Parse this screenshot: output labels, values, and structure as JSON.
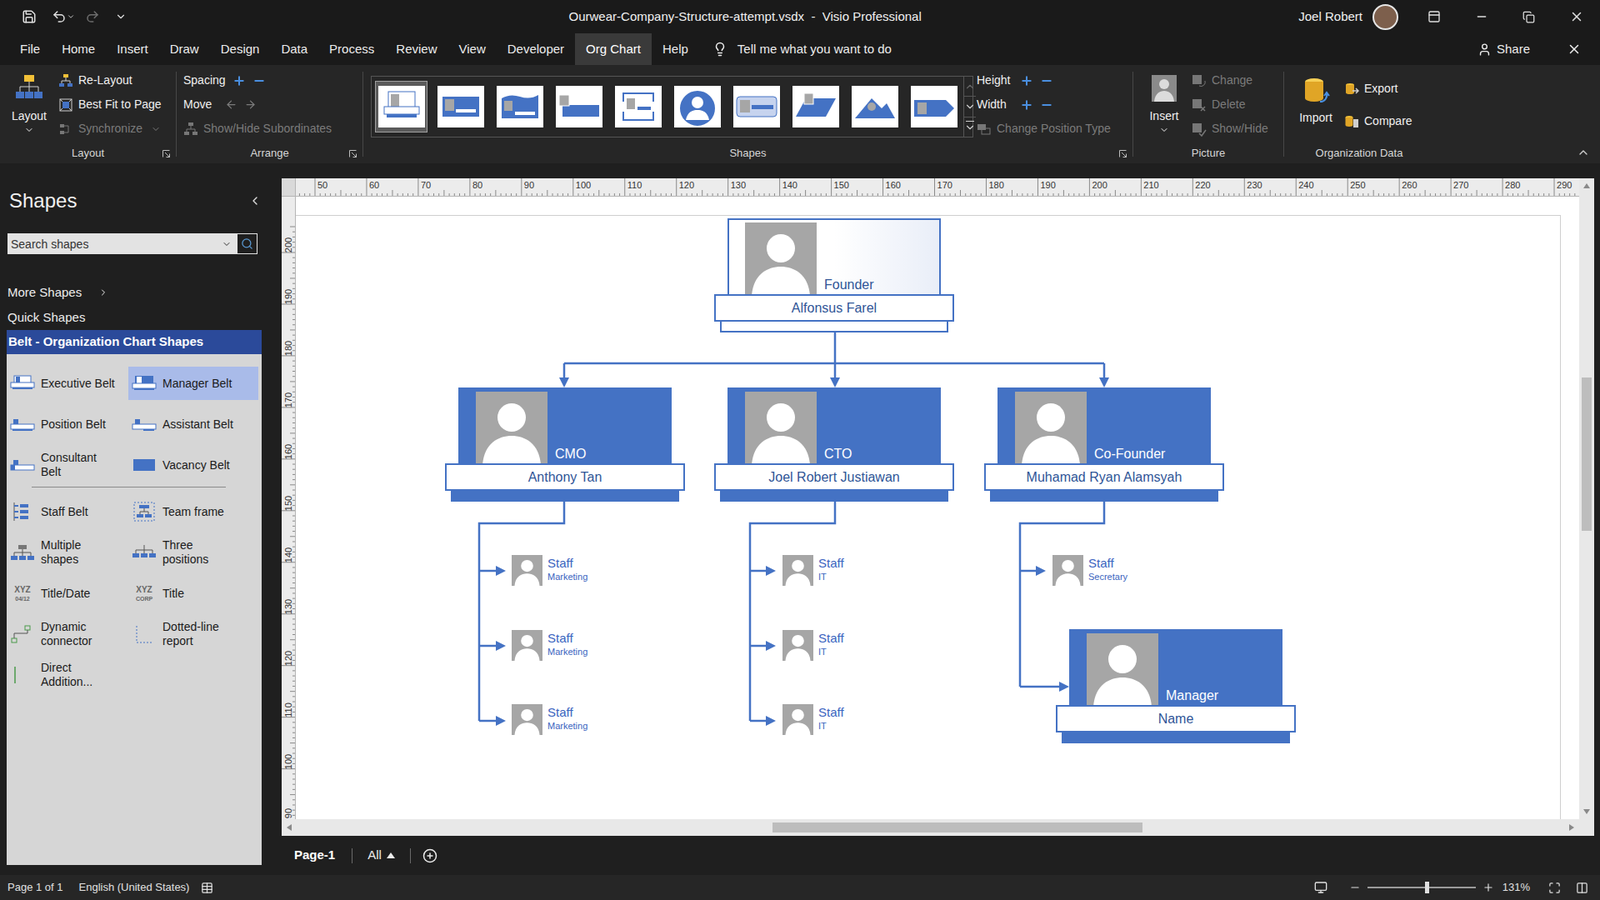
{
  "window": {
    "title": "Ourwear-Company-Structure-attempt.vsdx  -  Visio Professional",
    "user": "Joel Robert"
  },
  "menu": [
    {
      "label": "File",
      "selected": false
    },
    {
      "label": "Home",
      "selected": false
    },
    {
      "label": "Insert",
      "selected": false
    },
    {
      "label": "Draw",
      "selected": false
    },
    {
      "label": "Design",
      "selected": false
    },
    {
      "label": "Data",
      "selected": false
    },
    {
      "label": "Process",
      "selected": false
    },
    {
      "label": "Review",
      "selected": false
    },
    {
      "label": "View",
      "selected": false
    },
    {
      "label": "Developer",
      "selected": false
    },
    {
      "label": "Org Chart",
      "selected": true
    },
    {
      "label": "Help",
      "selected": false
    }
  ],
  "tell_me": "Tell me what you want to do",
  "share": "Share",
  "ribbon": {
    "layout": {
      "label": "Layout",
      "main": "Layout",
      "items": [
        {
          "label": "Re-Layout",
          "disabled": false,
          "kind": "relayout"
        },
        {
          "label": "Best Fit to Page",
          "disabled": false,
          "kind": "bestfit"
        },
        {
          "label": "Synchronize",
          "disabled": true,
          "kind": "sync"
        }
      ]
    },
    "arrange": {
      "label": "Arrange",
      "spacing": "Spacing",
      "move": "Move",
      "subordinates": {
        "label": "Show/Hide Subordinates",
        "disabled": true
      }
    },
    "shapes": {
      "label": "Shapes",
      "styles": [
        {
          "kind": "belt",
          "selected": true
        },
        {
          "kind": "block",
          "selected": false
        },
        {
          "kind": "notch",
          "selected": false
        },
        {
          "kind": "tab",
          "selected": false
        },
        {
          "kind": "bracket",
          "selected": false
        },
        {
          "kind": "circle",
          "selected": false
        },
        {
          "kind": "card",
          "selected": false
        },
        {
          "kind": "ribbon",
          "selected": false
        },
        {
          "kind": "triangle",
          "selected": false
        },
        {
          "kind": "arrow",
          "selected": false
        }
      ],
      "height": "Height",
      "width": "Width",
      "position_type": {
        "label": "Change Position Type",
        "disabled": true
      }
    },
    "picture": {
      "label": "Picture",
      "insert": "Insert",
      "items": [
        {
          "label": "Change",
          "disabled": true
        },
        {
          "label": "Delete",
          "disabled": true
        },
        {
          "label": "Show/Hide",
          "disabled": true
        }
      ]
    },
    "org_data": {
      "label": "Organization Data",
      "import": "Import",
      "items": [
        {
          "label": "Export",
          "disabled": false
        },
        {
          "label": "Compare",
          "disabled": false
        }
      ]
    }
  },
  "shapes_pane": {
    "title": "Shapes",
    "search_placeholder": "Search shapes",
    "links": [
      {
        "label": "More Shapes",
        "has_submenu": true
      },
      {
        "label": "Quick Shapes",
        "has_submenu": false
      }
    ],
    "stencil": {
      "label": "Belt - Organization Chart Shapes",
      "selected": true
    },
    "groups": [
      [
        {
          "label": "Executive Belt",
          "kind": "executive",
          "selected": false
        },
        {
          "label": "Manager Belt",
          "kind": "manager",
          "selected": true
        },
        {
          "label": "Position Belt",
          "kind": "position",
          "selected": false
        },
        {
          "label": "Assistant Belt",
          "kind": "assistant",
          "selected": false
        },
        {
          "label": "Consultant Belt",
          "kind": "consultant",
          "selected": false
        },
        {
          "label": "Vacancy Belt",
          "kind": "vacancy",
          "selected": false
        }
      ],
      [
        {
          "label": "Staff Belt",
          "kind": "staff",
          "selected": false
        },
        {
          "label": "Team frame",
          "kind": "team",
          "selected": false
        },
        {
          "label": "Multiple shapes",
          "kind": "multiple",
          "selected": false
        },
        {
          "label": "Three positions",
          "kind": "three",
          "selected": false
        },
        {
          "label": "Title/Date",
          "kind": "titledate",
          "selected": false,
          "icon_text": "XYZ",
          "icon_subtext": "04/12"
        },
        {
          "label": "Title",
          "kind": "title",
          "selected": false,
          "icon_text": "XYZ",
          "icon_subtext": "CORP"
        },
        {
          "label": "Dynamic connector",
          "kind": "connector",
          "selected": false
        },
        {
          "label": "Dotted-line report",
          "kind": "dotted",
          "selected": false
        },
        {
          "label": "Direct Addition...",
          "kind": "direct",
          "selected": false
        }
      ]
    ]
  },
  "rulers": {
    "horizontal": [
      "50",
      "60",
      "70",
      "80",
      "90",
      "100",
      "110",
      "120",
      "130",
      "140",
      "150",
      "160",
      "170",
      "180",
      "190",
      "200",
      "210",
      "220",
      "230",
      "240",
      "250",
      "260",
      "270",
      "280",
      "290"
    ],
    "vertical": [
      "200",
      "190",
      "180",
      "170",
      "160",
      "150",
      "140",
      "130",
      "120",
      "110",
      "100",
      "90"
    ]
  },
  "chart": {
    "executives": [
      {
        "title": "Founder",
        "name": "Alfonsus Farel",
        "kind": "outline"
      },
      {
        "title": "CMO",
        "name": "Anthony Tan",
        "kind": "filled"
      },
      {
        "title": "CTO",
        "name": "Joel Robert Justiawan",
        "kind": "filled"
      },
      {
        "title": "Co-Founder",
        "name": "Muhamad Ryan Alamsyah",
        "kind": "filled"
      },
      {
        "title": "Manager",
        "name": "Name",
        "kind": "filled"
      }
    ],
    "staff": [
      {
        "title": "Staff",
        "dept": "Marketing"
      },
      {
        "title": "Staff",
        "dept": "Marketing"
      },
      {
        "title": "Staff",
        "dept": "Marketing"
      },
      {
        "title": "Staff",
        "dept": "IT"
      },
      {
        "title": "Staff",
        "dept": "IT"
      },
      {
        "title": "Staff",
        "dept": "IT"
      },
      {
        "title": "Staff",
        "dept": "Secretary"
      }
    ]
  },
  "pages": {
    "tabs": [
      {
        "label": "Page-1",
        "selected": true
      }
    ],
    "all": "All"
  },
  "status": {
    "page": "Page 1 of 1",
    "language": "English (United States)",
    "zoom": {
      "level": 0.55,
      "reading": "131%"
    }
  }
}
